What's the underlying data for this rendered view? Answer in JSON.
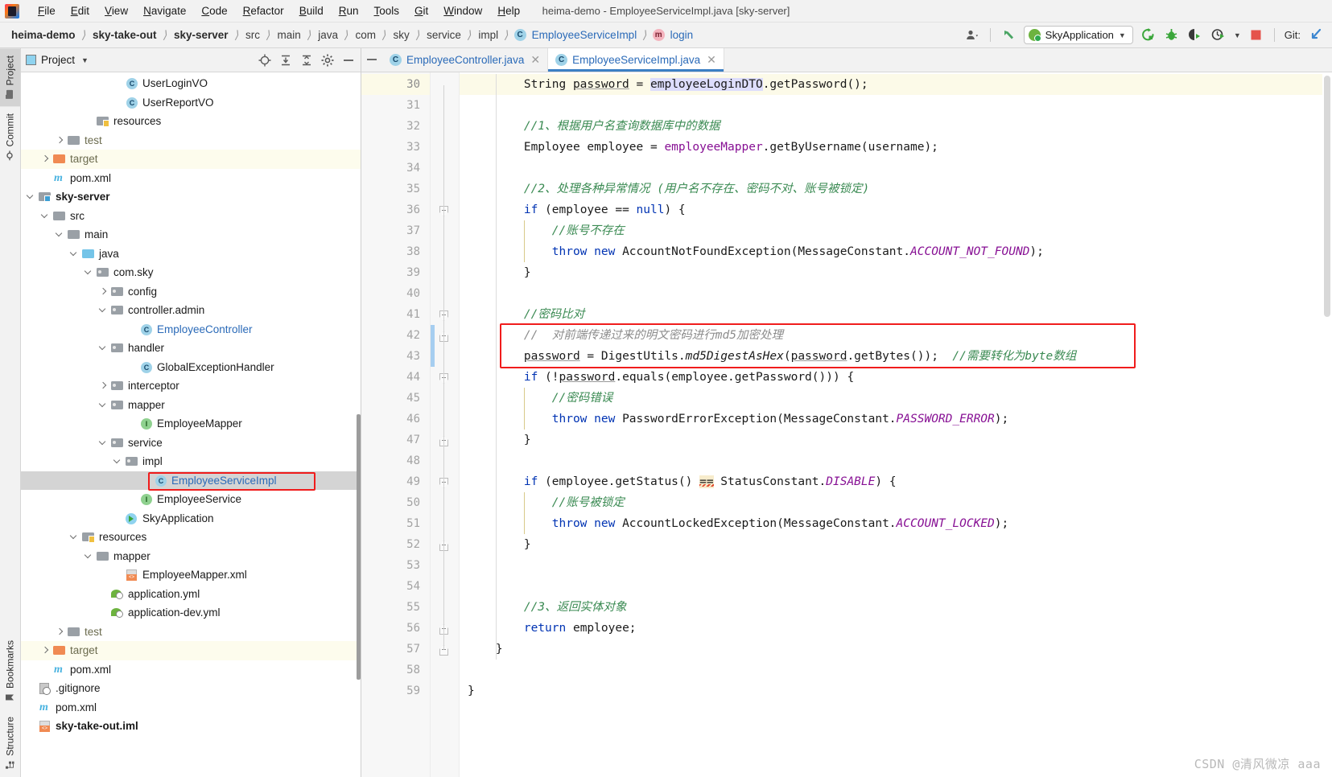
{
  "window": {
    "title": "heima-demo - EmployeeServiceImpl.java [sky-server]"
  },
  "menubar": {
    "items": [
      {
        "label": "File"
      },
      {
        "label": "Edit"
      },
      {
        "label": "View"
      },
      {
        "label": "Navigate"
      },
      {
        "label": "Code"
      },
      {
        "label": "Refactor"
      },
      {
        "label": "Build"
      },
      {
        "label": "Run"
      },
      {
        "label": "Tools"
      },
      {
        "label": "Git"
      },
      {
        "label": "Window"
      },
      {
        "label": "Help"
      }
    ]
  },
  "breadcrumb": {
    "items": [
      {
        "label": "heima-demo",
        "style": "bold"
      },
      {
        "label": "sky-take-out",
        "style": "bold"
      },
      {
        "label": "sky-server",
        "style": "bold"
      },
      {
        "label": "src",
        "style": "plain"
      },
      {
        "label": "main",
        "style": "plain"
      },
      {
        "label": "java",
        "style": "plain"
      },
      {
        "label": "com",
        "style": "plain"
      },
      {
        "label": "sky",
        "style": "plain"
      },
      {
        "label": "service",
        "style": "plain"
      },
      {
        "label": "impl",
        "style": "plain"
      },
      {
        "label": "EmployeeServiceImpl",
        "style": "class"
      },
      {
        "label": "login",
        "style": "method"
      }
    ]
  },
  "toolbar": {
    "run_config_label": "SkyApplication",
    "git_label": "Git:",
    "icons": [
      "user-account-icon",
      "back-arrow-icon",
      "rerun-icon",
      "debug-icon",
      "run-with-coverage-icon",
      "profiler-icon",
      "stop-icon",
      "git-update-icon"
    ]
  },
  "toolstrip": {
    "top": [
      {
        "label": "Project",
        "icon": "project-folder-icon",
        "active": true
      },
      {
        "label": "Commit",
        "icon": "commit-icon",
        "active": false
      }
    ],
    "bottom": [
      {
        "label": "Bookmarks",
        "icon": "bookmark-icon",
        "active": false
      },
      {
        "label": "Structure",
        "icon": "structure-icon",
        "active": false
      }
    ]
  },
  "project_panel": {
    "title": "Project",
    "header_icons": [
      "locate-icon",
      "expand-all-icon",
      "collapse-all-icon",
      "settings-gear-icon",
      "hide-panel-icon"
    ],
    "tree": [
      {
        "label": "UserLoginVO",
        "indent": 9,
        "arrow": "none",
        "icon": "class-icon",
        "style": "plain"
      },
      {
        "label": "UserReportVO",
        "indent": 9,
        "arrow": "none",
        "icon": "class-icon",
        "style": "plain"
      },
      {
        "label": "resources",
        "indent": 7,
        "arrow": "none",
        "icon": "resources-folder-icon",
        "style": "plain"
      },
      {
        "label": "test",
        "indent": 5,
        "arrow": "right",
        "icon": "folder-gray-icon",
        "style": "dim"
      },
      {
        "label": "target",
        "indent": 4,
        "arrow": "right",
        "icon": "folder-orange-icon",
        "style": "dim",
        "highlight": "yellow"
      },
      {
        "label": "pom.xml",
        "indent": 4,
        "arrow": "none",
        "icon": "maven-icon",
        "style": "plain"
      },
      {
        "label": "sky-server",
        "indent": 3,
        "arrow": "down",
        "icon": "module-folder-icon",
        "style": "bold"
      },
      {
        "label": "src",
        "indent": 4,
        "arrow": "down",
        "icon": "folder-gray-icon",
        "style": "plain"
      },
      {
        "label": "main",
        "indent": 5,
        "arrow": "down",
        "icon": "folder-gray-icon",
        "style": "plain"
      },
      {
        "label": "java",
        "indent": 6,
        "arrow": "down",
        "icon": "folder-blue-icon",
        "style": "plain"
      },
      {
        "label": "com.sky",
        "indent": 7,
        "arrow": "down",
        "icon": "package-icon",
        "style": "plain"
      },
      {
        "label": "config",
        "indent": 8,
        "arrow": "right",
        "icon": "package-icon",
        "style": "plain"
      },
      {
        "label": "controller.admin",
        "indent": 8,
        "arrow": "down",
        "icon": "package-icon",
        "style": "plain"
      },
      {
        "label": "EmployeeController",
        "indent": 10,
        "arrow": "none",
        "icon": "class-icon",
        "style": "blue"
      },
      {
        "label": "handler",
        "indent": 8,
        "arrow": "down",
        "icon": "package-icon",
        "style": "plain"
      },
      {
        "label": "GlobalExceptionHandler",
        "indent": 10,
        "arrow": "none",
        "icon": "class-icon",
        "style": "plain"
      },
      {
        "label": "interceptor",
        "indent": 8,
        "arrow": "right",
        "icon": "package-icon",
        "style": "plain"
      },
      {
        "label": "mapper",
        "indent": 8,
        "arrow": "down",
        "icon": "package-icon",
        "style": "plain"
      },
      {
        "label": "EmployeeMapper",
        "indent": 10,
        "arrow": "none",
        "icon": "interface-icon",
        "style": "plain"
      },
      {
        "label": "service",
        "indent": 8,
        "arrow": "down",
        "icon": "package-icon",
        "style": "plain"
      },
      {
        "label": "impl",
        "indent": 9,
        "arrow": "down",
        "icon": "package-icon",
        "style": "plain"
      },
      {
        "label": "EmployeeServiceImpl",
        "indent": 11,
        "arrow": "none",
        "icon": "class-icon",
        "style": "blue",
        "highlight": "gray",
        "annotated": true
      },
      {
        "label": "EmployeeService",
        "indent": 10,
        "arrow": "none",
        "icon": "interface-icon",
        "style": "plain"
      },
      {
        "label": "SkyApplication",
        "indent": 9,
        "arrow": "none",
        "icon": "spring-boot-icon",
        "style": "plain"
      },
      {
        "label": "resources",
        "indent": 6,
        "arrow": "down",
        "icon": "resources-folder-icon",
        "style": "plain"
      },
      {
        "label": "mapper",
        "indent": 7,
        "arrow": "down",
        "icon": "folder-gray-icon",
        "style": "plain"
      },
      {
        "label": "EmployeeMapper.xml",
        "indent": 9,
        "arrow": "none",
        "icon": "xml-file-icon",
        "style": "plain"
      },
      {
        "label": "application.yml",
        "indent": 8,
        "arrow": "none",
        "icon": "yaml-spring-icon",
        "style": "plain"
      },
      {
        "label": "application-dev.yml",
        "indent": 8,
        "arrow": "none",
        "icon": "yaml-spring-icon",
        "style": "plain"
      },
      {
        "label": "test",
        "indent": 5,
        "arrow": "right",
        "icon": "folder-gray-icon",
        "style": "dim"
      },
      {
        "label": "target",
        "indent": 4,
        "arrow": "right",
        "icon": "folder-orange-icon",
        "style": "dim",
        "highlight": "yellow"
      },
      {
        "label": "pom.xml",
        "indent": 4,
        "arrow": "none",
        "icon": "maven-icon",
        "style": "plain"
      },
      {
        "label": ".gitignore",
        "indent": 3,
        "arrow": "none",
        "icon": "gitignore-icon",
        "style": "plain"
      },
      {
        "label": "pom.xml",
        "indent": 3,
        "arrow": "none",
        "icon": "maven-icon",
        "style": "plain"
      },
      {
        "label": "sky-take-out.iml",
        "indent": 3,
        "arrow": "none",
        "icon": "iml-icon",
        "style": "bold-cut"
      }
    ]
  },
  "editor_tabs": [
    {
      "label": "EmployeeController.java",
      "icon": "class-icon",
      "active": false,
      "closable": true
    },
    {
      "label": "EmployeeServiceImpl.java",
      "icon": "class-icon",
      "active": true,
      "closable": true
    }
  ],
  "code": {
    "first_line": 30,
    "current_line": 30,
    "annotated_lines": [
      42,
      43
    ],
    "lines": [
      {
        "n": 30,
        "tokens": [
          {
            "t": "        ",
            "c": "t"
          },
          {
            "t": "String ",
            "c": "t"
          },
          {
            "t": "password",
            "c": "t und"
          },
          {
            "t": " = ",
            "c": "t"
          },
          {
            "t": "employeeLoginDTO",
            "c": "t hi-var"
          },
          {
            "t": ".getPassword();",
            "c": "t"
          }
        ]
      },
      {
        "n": 31,
        "tokens": []
      },
      {
        "n": 32,
        "tokens": [
          {
            "t": "        ",
            "c": "t"
          },
          {
            "t": "//1、根据用户名查询数据库中的数据",
            "c": "cmg"
          }
        ]
      },
      {
        "n": 33,
        "tokens": [
          {
            "t": "        ",
            "c": "t"
          },
          {
            "t": "Employee employee = ",
            "c": "t"
          },
          {
            "t": "employeeMapper",
            "c": "fld"
          },
          {
            "t": ".getByUsername(username);",
            "c": "t"
          }
        ]
      },
      {
        "n": 34,
        "tokens": []
      },
      {
        "n": 35,
        "tokens": [
          {
            "t": "        ",
            "c": "t"
          },
          {
            "t": "//2、处理各种异常情况 (用户名不存在、密码不对、账号被锁定)",
            "c": "cmg"
          }
        ]
      },
      {
        "n": 36,
        "tokens": [
          {
            "t": "        ",
            "c": "t"
          },
          {
            "t": "if",
            "c": "k"
          },
          {
            "t": " (employee == ",
            "c": "t"
          },
          {
            "t": "null",
            "c": "k"
          },
          {
            "t": ") {",
            "c": "t"
          }
        ]
      },
      {
        "n": 37,
        "tokens": [
          {
            "t": "            ",
            "c": "t"
          },
          {
            "t": "//账号不存在",
            "c": "cmg"
          }
        ]
      },
      {
        "n": 38,
        "tokens": [
          {
            "t": "            ",
            "c": "t"
          },
          {
            "t": "throw new",
            "c": "k"
          },
          {
            "t": " AccountNotFoundException(MessageConstant.",
            "c": "t"
          },
          {
            "t": "ACCOUNT_NOT_FOUND",
            "c": "cst"
          },
          {
            "t": ");",
            "c": "t"
          }
        ]
      },
      {
        "n": 39,
        "tokens": [
          {
            "t": "        ",
            "c": "t"
          },
          {
            "t": "}",
            "c": "t"
          }
        ]
      },
      {
        "n": 40,
        "tokens": []
      },
      {
        "n": 41,
        "tokens": [
          {
            "t": "        ",
            "c": "t"
          },
          {
            "t": "//密码比对",
            "c": "cmg"
          }
        ]
      },
      {
        "n": 42,
        "tokens": [
          {
            "t": "        ",
            "c": "t"
          },
          {
            "t": "//  对前端传递过来的明文密码进行md5加密处理",
            "c": "cm"
          }
        ]
      },
      {
        "n": 43,
        "tokens": [
          {
            "t": "        ",
            "c": "t"
          },
          {
            "t": "password",
            "c": "t und"
          },
          {
            "t": " = DigestUtils.",
            "c": "t"
          },
          {
            "t": "md5DigestAsHex",
            "c": "mthI"
          },
          {
            "t": "(",
            "c": "par"
          },
          {
            "t": "password",
            "c": "t und"
          },
          {
            "t": ".getBytes());  ",
            "c": "t"
          },
          {
            "t": "//需要转化为byte数组",
            "c": "cmg"
          }
        ]
      },
      {
        "n": 44,
        "tokens": [
          {
            "t": "        ",
            "c": "t"
          },
          {
            "t": "if",
            "c": "k"
          },
          {
            "t": " (!",
            "c": "t"
          },
          {
            "t": "password",
            "c": "t und"
          },
          {
            "t": ".equals(employee.getPassword())) {",
            "c": "t"
          }
        ]
      },
      {
        "n": 45,
        "tokens": [
          {
            "t": "            ",
            "c": "t"
          },
          {
            "t": "//密码错误",
            "c": "cmg"
          }
        ]
      },
      {
        "n": 46,
        "tokens": [
          {
            "t": "            ",
            "c": "t"
          },
          {
            "t": "throw new",
            "c": "k"
          },
          {
            "t": " PasswordErrorException(MessageConstant.",
            "c": "t"
          },
          {
            "t": "PASSWORD_ERROR",
            "c": "cst"
          },
          {
            "t": ");",
            "c": "t"
          }
        ]
      },
      {
        "n": 47,
        "tokens": [
          {
            "t": "        ",
            "c": "t"
          },
          {
            "t": "}",
            "c": "t"
          }
        ]
      },
      {
        "n": 48,
        "tokens": []
      },
      {
        "n": 49,
        "tokens": [
          {
            "t": "        ",
            "c": "t"
          },
          {
            "t": "if",
            "c": "k"
          },
          {
            "t": " (employee.getStatus() ",
            "c": "t"
          },
          {
            "t": "==",
            "c": "t hi-eq"
          },
          {
            "t": " StatusConstant.",
            "c": "t"
          },
          {
            "t": "DISABLE",
            "c": "cst"
          },
          {
            "t": ") {",
            "c": "t"
          }
        ]
      },
      {
        "n": 50,
        "tokens": [
          {
            "t": "            ",
            "c": "t"
          },
          {
            "t": "//账号被锁定",
            "c": "cmg"
          }
        ]
      },
      {
        "n": 51,
        "tokens": [
          {
            "t": "            ",
            "c": "t"
          },
          {
            "t": "throw new",
            "c": "k"
          },
          {
            "t": " AccountLockedException(MessageConstant.",
            "c": "t"
          },
          {
            "t": "ACCOUNT_LOCKED",
            "c": "cst"
          },
          {
            "t": ");",
            "c": "t"
          }
        ]
      },
      {
        "n": 52,
        "tokens": [
          {
            "t": "        ",
            "c": "t"
          },
          {
            "t": "}",
            "c": "t"
          }
        ]
      },
      {
        "n": 53,
        "tokens": []
      },
      {
        "n": 54,
        "tokens": []
      },
      {
        "n": 55,
        "tokens": [
          {
            "t": "        ",
            "c": "t"
          },
          {
            "t": "//3、返回实体对象",
            "c": "cmg"
          }
        ]
      },
      {
        "n": 56,
        "tokens": [
          {
            "t": "        ",
            "c": "t"
          },
          {
            "t": "return",
            "c": "k"
          },
          {
            "t": " employee;",
            "c": "t"
          }
        ]
      },
      {
        "n": 57,
        "tokens": [
          {
            "t": "    ",
            "c": "t"
          },
          {
            "t": "}",
            "c": "t"
          }
        ]
      },
      {
        "n": 58,
        "tokens": []
      },
      {
        "n": 59,
        "tokens": [
          {
            "t": "}",
            "c": "t"
          }
        ]
      }
    ]
  },
  "watermark": "CSDN @清风微凉 aaa",
  "colors": {
    "accent_blue": "#2a6ab8",
    "annotation_red": "#f01c1c",
    "keyword": "#0033b3",
    "comment_green": "#3a8a52",
    "comment_gray": "#8c8c8c",
    "constant_purple": "#871094",
    "selection_gray": "#d4d4d4",
    "highlight_yellow": "#fdfced"
  }
}
